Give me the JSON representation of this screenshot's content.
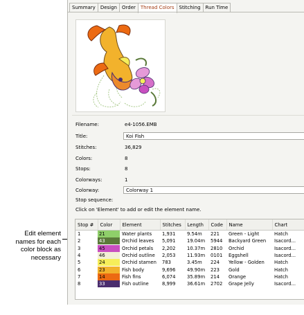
{
  "callout": {
    "line1": "Edit element",
    "line2": "names for each",
    "line3": "color block as",
    "line4": "necessary"
  },
  "tabs": [
    "Summary",
    "Design",
    "Order",
    "Thread Colors",
    "Stitching",
    "Run Time"
  ],
  "active_tab": "Thread Colors",
  "preview_image": "koi-fish-embroidery-thumbnail",
  "properties": {
    "filename_label": "Filename:",
    "filename": "e4-1056.EMB",
    "title_label": "Title:",
    "title": "Koi Fish",
    "stitches_label": "Stitches:",
    "stitches": "36,829",
    "colors_label": "Colors:",
    "colors": "8",
    "stops_label": "Stops:",
    "stops": "8",
    "colorways_label": "Colorways:",
    "colorways": "1",
    "colorway_label": "Colorway:",
    "colorway": "Colorway 1",
    "stop_sequence_label": "Stop sequence:"
  },
  "hint": "Click on 'Element' to add or edit the element name.",
  "table": {
    "headers": [
      "Stop #",
      "Color",
      "Element",
      "Stitches",
      "Length",
      "Code",
      "Name",
      "Chart"
    ],
    "rows": [
      {
        "stop": "1",
        "color": "21",
        "hex": "#8fcf6a",
        "text": "#000",
        "element": "Water plants",
        "stitches": "1,931",
        "length": "9.54m",
        "code": "221",
        "name": "Green - Light",
        "chart": "Hatch"
      },
      {
        "stop": "2",
        "color": "43",
        "hex": "#5b7a3a",
        "text": "#fff",
        "element": "Orchid leaves",
        "stitches": "5,091",
        "length": "19.04m",
        "code": "5944",
        "name": "Backyard Green",
        "chart": "Isacord..."
      },
      {
        "stop": "3",
        "color": "45",
        "hex": "#c84fc0",
        "text": "#000",
        "element": "Orchid petals",
        "stitches": "2,202",
        "length": "10.37m",
        "code": "2810",
        "name": "Orchid",
        "chart": "Isacord..."
      },
      {
        "stop": "4",
        "color": "46",
        "hex": "#f3efd6",
        "text": "#000",
        "element": "Orchid outline",
        "stitches": "2,053",
        "length": "11.93m",
        "code": "0101",
        "name": "Eggshell",
        "chart": "Isacord..."
      },
      {
        "stop": "5",
        "color": "24",
        "hex": "#f6ee5a",
        "text": "#000",
        "element": "Orchid stamen",
        "stitches": "783",
        "length": "3.45m",
        "code": "224",
        "name": "Yellow - Golden",
        "chart": "Hatch"
      },
      {
        "stop": "6",
        "color": "23",
        "hex": "#f2b22c",
        "text": "#000",
        "element": "Fish body",
        "stitches": "9,696",
        "length": "49.90m",
        "code": "223",
        "name": "Gold",
        "chart": "Hatch"
      },
      {
        "stop": "7",
        "color": "14",
        "hex": "#ec6a12",
        "text": "#000",
        "element": "Fish fins",
        "stitches": "6,074",
        "length": "35.89m",
        "code": "214",
        "name": "Orange",
        "chart": "Hatch"
      },
      {
        "stop": "8",
        "color": "33",
        "hex": "#4a2d6e",
        "text": "#fff",
        "element": "Fish outline",
        "stitches": "8,999",
        "length": "36.61m",
        "code": "2702",
        "name": "Grape Jelly",
        "chart": "Isacord..."
      }
    ]
  }
}
